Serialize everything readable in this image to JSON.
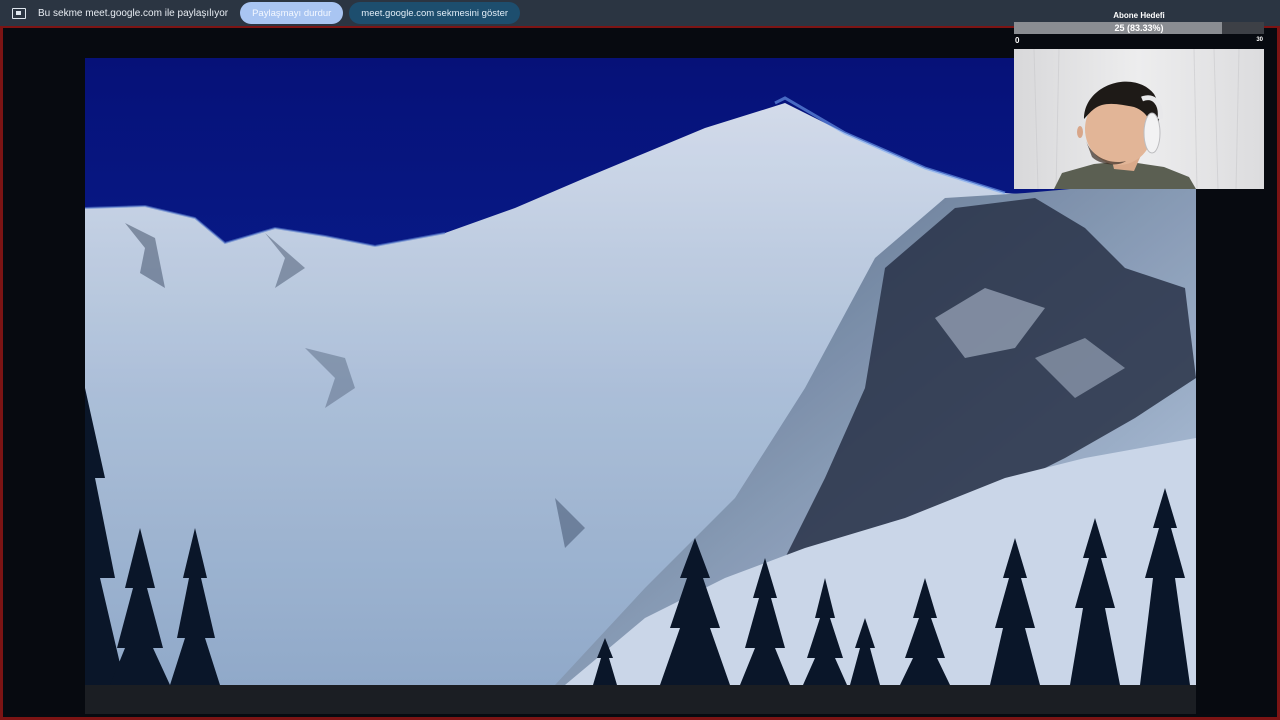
{
  "share_bar": {
    "icon": "screen-share-icon",
    "message": "Bu sekme meet.google.com ile paylaşılıyor",
    "stop_label": "Paylaşmayı durdur",
    "show_label": "meet.google.com sekmesini göster"
  },
  "shared_content": {
    "image": "snowy-mountain-landscape"
  },
  "subscriber_goal": {
    "title": "Abone Hedefi",
    "progress_text": "25 (83.33%)",
    "current": 25,
    "goal": 30,
    "progress_fraction": 0.8333,
    "min_label": "0",
    "max_label": "30"
  },
  "webcam": {
    "content": "person-with-headphones"
  },
  "colors": {
    "frame_border": "#7c1414",
    "share_bar_bg": "#2b3542",
    "stop_button_bg": "#a9c5f2",
    "show_button_bg": "#1d4e6e",
    "sky": "#0a1a8a"
  }
}
